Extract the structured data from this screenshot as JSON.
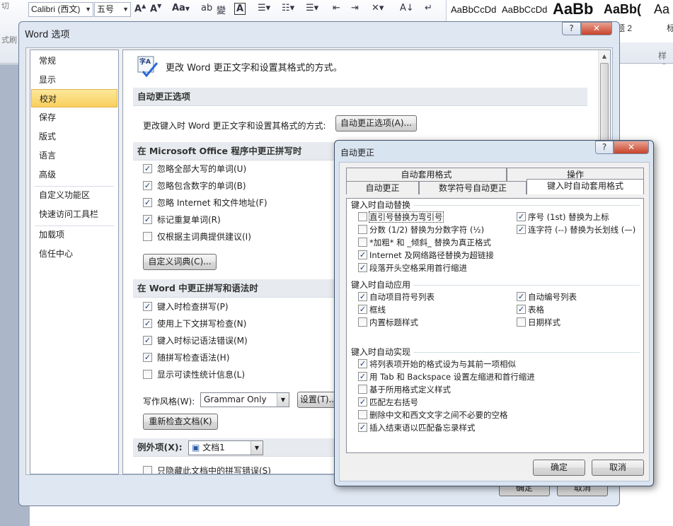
{
  "ribbon": {
    "left_labels": [
      "切",
      "式刷"
    ],
    "font_name": "Calibri (西文)",
    "font_size": "五号",
    "grow_font": "A",
    "shrink_font": "A",
    "change_case": "Aa",
    "clear_format": "A",
    "styles": [
      "AaBbCcDd",
      "AaBbCcDd",
      "AaBb",
      "AaBb(",
      "Aa"
    ],
    "style_labels": [
      "题 2",
      "标"
    ],
    "group_style_label": "样式"
  },
  "word_options": {
    "title": "Word 选项",
    "help_btn": "?",
    "close_btn": "✕",
    "nav": [
      "常规",
      "显示",
      "校对",
      "保存",
      "版式",
      "语言",
      "高级",
      "自定义功能区",
      "快速访问工具栏",
      "加载项",
      "信任中心"
    ],
    "selected_index": 2,
    "header_text": "更改 Word 更正文字和设置其格式的方式。",
    "icon_text": "字A",
    "sec_autocorrect": "自动更正选项",
    "autocorrect_desc": "更改键入时 Word 更正文字和设置其格式的方式:",
    "autocorrect_btn": "自动更正选项(A)...",
    "sec_office": "在 Microsoft Office 程序中更正拼写时",
    "office_checks": [
      {
        "label": "忽略全部大写的单词(U)",
        "checked": true
      },
      {
        "label": "忽略包含数字的单词(B)",
        "checked": true
      },
      {
        "label": "忽略 Internet 和文件地址(F)",
        "checked": true
      },
      {
        "label": "标记重复单词(R)",
        "checked": true
      },
      {
        "label": "仅根据主词典提供建议(I)",
        "checked": false
      }
    ],
    "dict_btn": "自定义词典(C)...",
    "sec_word": "在 Word 中更正拼写和语法时",
    "word_checks": [
      {
        "label": "键入时检查拼写(P)",
        "checked": true
      },
      {
        "label": "使用上下文拼写检查(N)",
        "checked": true
      },
      {
        "label": "键入时标记语法错误(M)",
        "checked": true
      },
      {
        "label": "随拼写检查语法(H)",
        "checked": true
      },
      {
        "label": "显示可读性统计信息(L)",
        "checked": false
      }
    ],
    "style_label": "写作风格(W):",
    "style_value": "Grammar Only",
    "settings_btn": "设置(T)...",
    "recheck_btn": "重新检查文档(K)",
    "exceptions_label": "例外项(X):",
    "exceptions_value": "文档1",
    "hide_errors": "只隐藏此文档中的拼写错误(S)",
    "ok": "确定",
    "cancel": "取消"
  },
  "autocorrect": {
    "title": "自动更正",
    "help_btn": "?",
    "close_btn": "✕",
    "tabs_top": [
      "自动套用格式",
      "操作"
    ],
    "tabs_bottom": [
      "自动更正",
      "数学符号自动更正",
      "键入时自动套用格式"
    ],
    "grp_replace": "键入时自动替换",
    "replace_left": [
      {
        "label": "直引号替换为弯引号",
        "checked": false
      },
      {
        "label": "分数 (1/2) 替换为分数字符 (½)",
        "checked": false
      },
      {
        "label": "*加粗* 和 _倾斜_ 替换为真正格式",
        "checked": false
      },
      {
        "label": "Internet 及网络路径替换为超链接",
        "checked": true
      },
      {
        "label": "段落开头空格采用首行缩进",
        "checked": true
      }
    ],
    "replace_right": [
      {
        "label": "序号 (1st) 替换为上标",
        "checked": true
      },
      {
        "label": "连字符 (--) 替换为长划线 (—)",
        "checked": true
      }
    ],
    "grp_apply": "键入时自动应用",
    "apply_left": [
      {
        "label": "自动项目符号列表",
        "checked": true
      },
      {
        "label": "框线",
        "checked": true
      },
      {
        "label": "内置标题样式",
        "checked": false
      }
    ],
    "apply_right": [
      {
        "label": "自动编号列表",
        "checked": true
      },
      {
        "label": "表格",
        "checked": true
      },
      {
        "label": "日期样式",
        "checked": false
      }
    ],
    "grp_auto": "键入时自动实现",
    "auto_checks": [
      {
        "label": "将列表项开始的格式设为与其前一项相似",
        "checked": true
      },
      {
        "label": "用 Tab 和 Backspace 设置左缩进和首行缩进",
        "checked": true
      },
      {
        "label": "基于所用格式定义样式",
        "checked": false
      },
      {
        "label": "匹配左右括号",
        "checked": true
      },
      {
        "label": "删除中文和西文文字之间不必要的空格",
        "checked": false
      },
      {
        "label": "插入结束语以匹配备忘录样式",
        "checked": true
      }
    ],
    "ok": "确定",
    "cancel": "取消"
  }
}
